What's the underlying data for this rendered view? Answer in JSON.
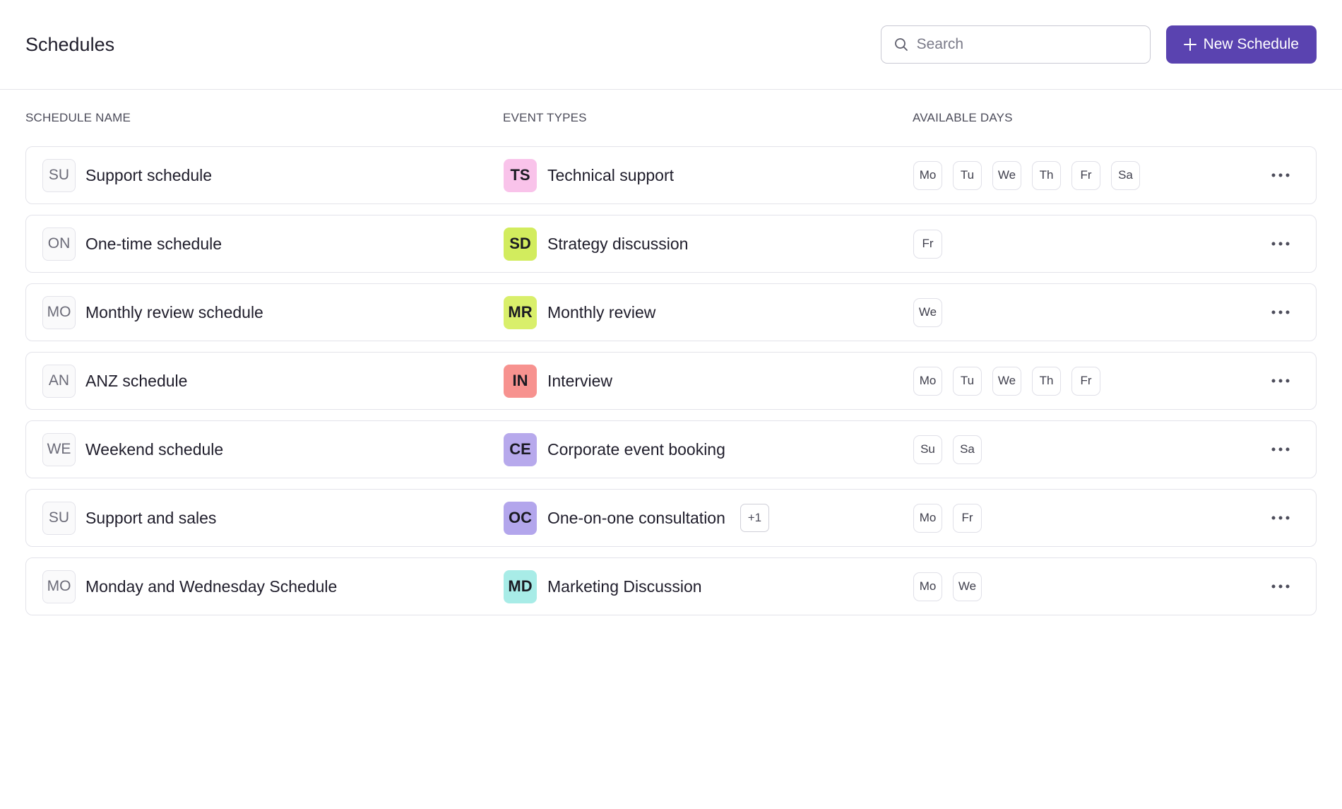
{
  "header": {
    "title": "Schedules",
    "search_placeholder": "Search",
    "new_button_label": "New Schedule",
    "accent_color": "#5a43b0"
  },
  "columns": {
    "name": "SCHEDULE NAME",
    "event_types": "EVENT TYPES",
    "available_days": "AVAILABLE DAYS"
  },
  "rows": [
    {
      "abbr": "SU",
      "name": "Support schedule",
      "event_abbr": "TS",
      "event_name": "Technical support",
      "event_color": "#f9c3ea",
      "extra": "",
      "days": [
        "Mo",
        "Tu",
        "We",
        "Th",
        "Fr",
        "Sa"
      ]
    },
    {
      "abbr": "ON",
      "name": "One-time schedule",
      "event_abbr": "SD",
      "event_name": "Strategy discussion",
      "event_color": "#d2ec5e",
      "extra": "",
      "days": [
        "Fr"
      ]
    },
    {
      "abbr": "MO",
      "name": "Monthly review schedule",
      "event_abbr": "MR",
      "event_name": "Monthly review",
      "event_color": "#d9ef6b",
      "extra": "",
      "days": [
        "We"
      ]
    },
    {
      "abbr": "AN",
      "name": "ANZ schedule",
      "event_abbr": "IN",
      "event_name": "Interview",
      "event_color": "#f7928f",
      "extra": "",
      "days": [
        "Mo",
        "Tu",
        "We",
        "Th",
        "Fr"
      ]
    },
    {
      "abbr": "WE",
      "name": "Weekend schedule",
      "event_abbr": "CE",
      "event_name": "Corporate event booking",
      "event_color": "#b7a9ec",
      "extra": "",
      "days": [
        "Su",
        "Sa"
      ]
    },
    {
      "abbr": "SU",
      "name": "Support and sales",
      "event_abbr": "OC",
      "event_name": "One-on-one consultation",
      "event_color": "#b3a6ec",
      "extra": "+1",
      "days": [
        "Mo",
        "Fr"
      ]
    },
    {
      "abbr": "MO",
      "name": "Monday and Wednesday Schedule",
      "event_abbr": "MD",
      "event_name": "Marketing Discussion",
      "event_color": "#a8ece7",
      "extra": "",
      "days": [
        "Mo",
        "We"
      ]
    }
  ]
}
